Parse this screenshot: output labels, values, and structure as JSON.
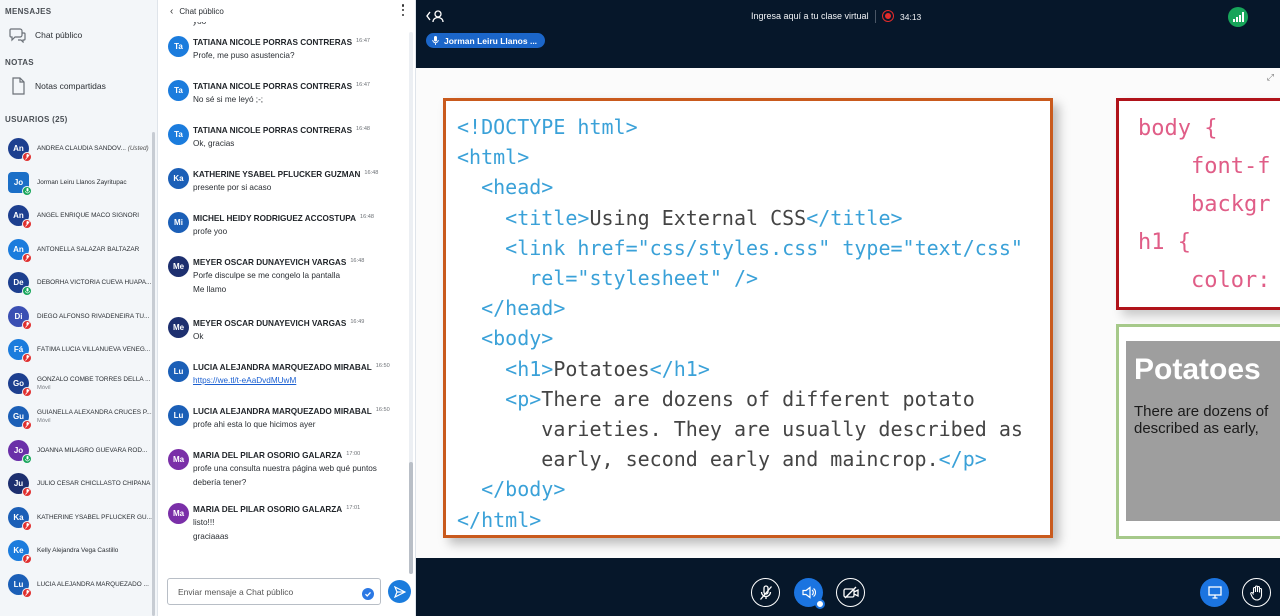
{
  "sidebar": {
    "messages_title": "MENSAJES",
    "public_chat": "Chat público",
    "notes_title": "NOTAS",
    "shared_notes": "Notas compartidas",
    "users_title": "USUARIOS (25)",
    "users": [
      {
        "initials": "An",
        "name": "ANDREA CLAUDIA SANDOV...",
        "you": "(Usted)",
        "color": "#1d3f8f",
        "status": "muted"
      },
      {
        "initials": "Jo",
        "name": "Jorman Leiru Llanos Zayritupac",
        "color": "#1b6fc7",
        "status": "talking",
        "presenter": true
      },
      {
        "initials": "An",
        "name": "ANGEL ENRIQUE MACO SIGNORI",
        "color": "#1d3f8f",
        "status": "muted"
      },
      {
        "initials": "An",
        "name": "ANTONELLA SALAZAR BALTAZAR",
        "color": "#1b7cdd",
        "status": "muted"
      },
      {
        "initials": "De",
        "name": "DEBORHA VICTORIA CUEVA HUAPA...",
        "color": "#1d3f8f",
        "status": "talking"
      },
      {
        "initials": "Di",
        "name": "DIEGO ALFONSO RIVADENEIRA TU...",
        "color": "#3a4fb3",
        "status": "muted"
      },
      {
        "initials": "Fá",
        "name": "FÁTIMA LUCIA VILLANUEVA VENEG...",
        "color": "#1b7cdd",
        "status": "muted"
      },
      {
        "initials": "Go",
        "name": "GONZALO COMBE TORRES DELLA ...",
        "sub": "Móvil",
        "color": "#1d3f8f",
        "status": "muted"
      },
      {
        "initials": "Gu",
        "name": "GUIANELLA ALEXANDRA CRUCES P...",
        "sub": "Móvil",
        "color": "#1b5fb7",
        "status": "muted"
      },
      {
        "initials": "Jo",
        "name": "JOANNA MILAGRO GUEVARA ROD...",
        "color": "#6a2fa8",
        "status": "talking"
      },
      {
        "initials": "Ju",
        "name": "JULIO CESAR CHICLLASTO CHIPANA",
        "color": "#1d2f6f",
        "status": "muted"
      },
      {
        "initials": "Ka",
        "name": "KATHERINE YSABEL PFLUCKER GU...",
        "color": "#1b5fb7",
        "status": "muted"
      },
      {
        "initials": "Ke",
        "name": "Kelly Alejandra Vega Castillo",
        "color": "#1b7cdd",
        "status": "muted"
      },
      {
        "initials": "Lu",
        "name": "LUCIA ALEJANDRA MARQUEZADO ...",
        "color": "#1b5fb7",
        "status": "muted"
      }
    ]
  },
  "chat": {
    "title": "Chat público",
    "top_partial": "yoo",
    "messages": [
      {
        "initials": "Ta",
        "color": "#1b7cdd",
        "author": "TATIANA NICOLE PORRAS CONTRERAS",
        "time": "16:47",
        "lines": [
          "Profe, me puso asustencia?"
        ]
      },
      {
        "initials": "Ta",
        "color": "#1b7cdd",
        "author": "TATIANA NICOLE PORRAS CONTRERAS",
        "time": "16:47",
        "lines": [
          "No sé si me leyó ;-;"
        ]
      },
      {
        "initials": "Ta",
        "color": "#1b7cdd",
        "author": "TATIANA NICOLE PORRAS CONTRERAS",
        "time": "16:48",
        "lines": [
          "Ok, gracias"
        ]
      },
      {
        "initials": "Ka",
        "color": "#1b5fb7",
        "author": "KATHERINE YSABEL PFLUCKER GUZMAN",
        "time": "16:48",
        "lines": [
          "presente por si acaso"
        ]
      },
      {
        "initials": "Mi",
        "color": "#1b5fb7",
        "author": "MICHEL HEIDY RODRIGUEZ ACCOSTUPA",
        "time": "16:48",
        "lines": [
          "profe yoo"
        ]
      },
      {
        "initials": "Me",
        "color": "#1d2f6f",
        "author": "MEYER OSCAR DUNAYEVICH VARGAS",
        "time": "16:48",
        "lines": [
          "Porfe disculpe se me congelo la pantalla",
          "Me llamo"
        ]
      },
      {
        "initials": "Me",
        "color": "#1d2f6f",
        "author": "MEYER OSCAR DUNAYEVICH VARGAS",
        "time": "16:49",
        "lines": [
          "Ok"
        ]
      },
      {
        "initials": "Lu",
        "color": "#1b5fb7",
        "author": "LUCIA ALEJANDRA MARQUEZADO MIRABAL",
        "time": "16:50",
        "lines": [
          "https://we.tl/t-eAaDvdMUwM"
        ],
        "link": true
      },
      {
        "initials": "Lu",
        "color": "#1b5fb7",
        "author": "LUCIA ALEJANDRA MARQUEZADO MIRABAL",
        "time": "16:50",
        "lines": [
          "profe ahi esta lo que hicimos ayer"
        ]
      },
      {
        "initials": "Ma",
        "color": "#7a2fa8",
        "author": "MARIA DEL PILAR OSORIO GALARZA",
        "time": "17:00",
        "lines": [
          "profe una consulta nuestra página web qué puntos",
          "debería tener?"
        ]
      },
      {
        "initials": "Ma",
        "color": "#7a2fa8",
        "author": "MARIA DEL PILAR OSORIO GALARZA",
        "time": "17:01",
        "lines": [
          "listo!!!",
          "graciaaas"
        ]
      }
    ],
    "input_placeholder": "Enviar mensaje a Chat público"
  },
  "topbar": {
    "title": "Ingresa aquí a tu clase virtual",
    "timer": "34:13",
    "talking_user": "Jorman Leiru Llanos ...",
    "rec_color": "#e32b2b",
    "conn_color": "#17a55a"
  },
  "slide": {
    "code_lines": [
      [
        {
          "t": 1,
          "s": "<!DOCTYPE html>"
        }
      ],
      [
        {
          "t": 1,
          "s": "<html>"
        }
      ],
      [
        {
          "t": 0,
          "s": "  "
        },
        {
          "t": 1,
          "s": "<head>"
        }
      ],
      [
        {
          "t": 0,
          "s": "    "
        },
        {
          "t": 1,
          "s": "<title>"
        },
        {
          "t": 0,
          "s": "Using External CSS"
        },
        {
          "t": 1,
          "s": "</title>"
        }
      ],
      [
        {
          "t": 0,
          "s": "    "
        },
        {
          "t": 1,
          "s": "<link href=\"css/styles.css\" type=\"text/css\""
        }
      ],
      [
        {
          "t": 0,
          "s": "      "
        },
        {
          "t": 1,
          "s": "rel=\"stylesheet\" />"
        }
      ],
      [
        {
          "t": 0,
          "s": "  "
        },
        {
          "t": 1,
          "s": "</head>"
        }
      ],
      [
        {
          "t": 0,
          "s": "  "
        },
        {
          "t": 1,
          "s": "<body>"
        }
      ],
      [
        {
          "t": 0,
          "s": "    "
        },
        {
          "t": 1,
          "s": "<h1>"
        },
        {
          "t": 0,
          "s": "Potatoes"
        },
        {
          "t": 1,
          "s": "</h1>"
        }
      ],
      [
        {
          "t": 0,
          "s": "    "
        },
        {
          "t": 1,
          "s": "<p>"
        },
        {
          "t": 0,
          "s": "There are dozens of different potato"
        }
      ],
      [
        {
          "t": 0,
          "s": "       varieties. They are usually described as"
        }
      ],
      [
        {
          "t": 0,
          "s": "       early, second early and maincrop."
        },
        {
          "t": 1,
          "s": "</p>"
        }
      ],
      [
        {
          "t": 0,
          "s": "  "
        },
        {
          "t": 1,
          "s": "</body>"
        }
      ],
      [
        {
          "t": 1,
          "s": "</html>"
        }
      ]
    ],
    "css_lines": [
      "body {",
      "    font-f",
      "    backgr",
      "h1 {",
      "    color:"
    ],
    "preview_heading": "Potatoes",
    "preview_lines": [
      "There are dozens of",
      "described as early,"
    ]
  }
}
